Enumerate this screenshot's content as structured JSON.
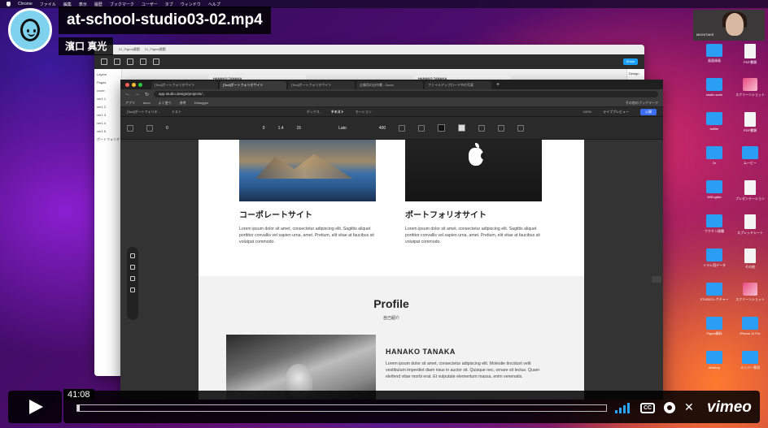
{
  "video": {
    "title": "at-school-studio03-02.mp4",
    "author": "濱口 真光",
    "current_time": "41:08",
    "progress_fraction": 0.005,
    "brand": "vimeo",
    "cc_label": "CC"
  },
  "menubar": {
    "items": [
      "Chrome",
      "ファイル",
      "編集",
      "表示",
      "履歴",
      "ブックマーク",
      "ユーザー",
      "タブ",
      "ウィンドウ",
      "ヘルプ"
    ]
  },
  "webcam": {
    "label": "MICHITAKE"
  },
  "desktop_icons": [
    {
      "label": "画面録画",
      "kind": "folder"
    },
    {
      "label": "PDF書類",
      "kind": "doc"
    },
    {
      "label": "studio-work",
      "kind": "folder"
    },
    {
      "label": "スクリーンショット",
      "kind": "pic"
    },
    {
      "label": "twitter",
      "kind": "folder"
    },
    {
      "label": "PDF書類",
      "kind": "doc"
    },
    {
      "label": "2x",
      "kind": "folder"
    },
    {
      "label": "ムービー",
      "kind": "folder"
    },
    {
      "label": "99English",
      "kind": "folder"
    },
    {
      "label": "プレゼンテーション",
      "kind": "doc"
    },
    {
      "label": "ワクチン接種",
      "kind": "folder"
    },
    {
      "label": "スプレッドシート",
      "kind": "doc"
    },
    {
      "label": "イラレ用データ",
      "kind": "folder"
    },
    {
      "label": "その他",
      "kind": "doc"
    },
    {
      "label": "STUDIOレクチャー",
      "kind": "folder"
    },
    {
      "label": "スクリーンショット",
      "kind": "pic"
    },
    {
      "label": "Figma資料",
      "kind": "folder"
    },
    {
      "label": "iPhone 11 Pro",
      "kind": "folder"
    },
    {
      "label": "desktop",
      "kind": "folder"
    },
    {
      "label": "メンバー専用",
      "kind": "folder"
    }
  ],
  "figma": {
    "tabs": [
      "01_Figma課題",
      "01_Figma課題"
    ],
    "share_label": "Share",
    "layers_title": "Layers",
    "layers": [
      "Pages",
      "cover",
      "ver1.1",
      "ver1.2",
      "ver1.3",
      "ver1.4",
      "ver1.5",
      "ポートフォリオ"
    ],
    "panel_title": "Design",
    "frame_a": "HANAKO TANAKA",
    "frame_b": "HANAKO TANAKA"
  },
  "chrome": {
    "tabs": [
      "[Tool]ポートフォリオサイト",
      "[Tool]ポートフォリオサイト",
      "[Tool]ポートフォリオサイト",
      "企業用の自作書 - Zoom",
      "ファイルアップロード中の写真"
    ],
    "active_tab_index": 1,
    "url": "app.studio.design/projects/...",
    "bookmarks": [
      "アプリ",
      "kono",
      "よく使う",
      "参考",
      "Debugger",
      "その他のブックマーク"
    ]
  },
  "studio": {
    "page_name": "[Tool]ポートフォリオ...",
    "tab_labels": [
      "テスト",
      "ボックス",
      "テキスト",
      "モーション"
    ],
    "active_tab": "テキスト",
    "zoom": "100%",
    "live_preview": "ライブプレビュー",
    "publish": "公開",
    "props": {
      "x": "0",
      "line_height": "1.4",
      "size": "15",
      "font": "Lato",
      "weight": "400"
    }
  },
  "page": {
    "cards": [
      {
        "title": "コーポレートサイト",
        "text": "Lorem ipsum dolor sit amet, consectetur adipiscing elit. Sagittis aliquet porttitor convallis vel sapien urna, amet. Pretium, elit vitae at faucibus sit volutpat commodo."
      },
      {
        "title": "ポートフォリオサイト",
        "text": "Lorem ipsum dolor sit amet, consectetur adipiscing elit. Sagittis aliquet porttitor convallis vel sapien urna, amet. Pretium, elit vitae at faucibus sit volutpat commodo."
      }
    ],
    "profile_title": "Profile",
    "profile_subtitle": "自己紹介",
    "profile_name": "HANAKO TANAKA",
    "profile_text": "Lorem ipsum dolor sit amet, consectetur adipiscing elit. Molestie tincidunt velit vestibulum imperdiet diam risus in auctor sit. Quisque nec, ornare sit lectus. Quam eleifend vitae morbi erat. Et vulputate elementum massa, enim venenatis."
  },
  "colors": {
    "vimeo_accent": "#2aa5ff",
    "publish_blue": "#3b6ef5",
    "figma_share": "#18a0fb",
    "folder_blue": "#2a9df4"
  }
}
